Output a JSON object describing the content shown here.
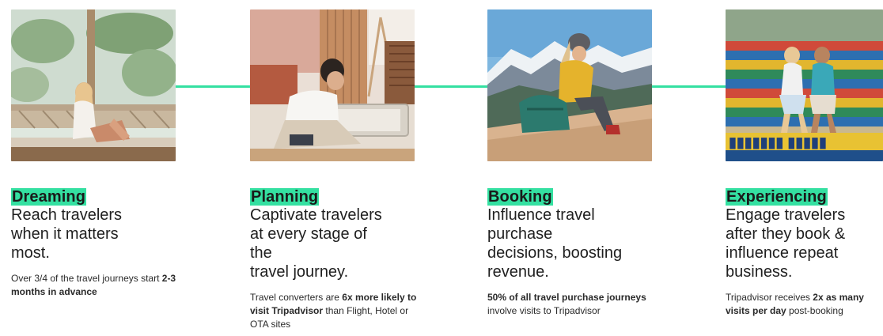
{
  "brand": {
    "accent": "#34e0a1"
  },
  "stages": [
    {
      "tag": "Dreaming",
      "headline": "Reach travelers\nwhen it matters\nmost.",
      "note_before": "Over 3/4 of the travel journeys start ",
      "note_bold": "2-3 months in advance",
      "note_after": "",
      "image": "woman sitting by window with palm trees"
    },
    {
      "tag": "Planning",
      "headline": "Captivate travelers\nat every stage of\nthe\ntravel journey.",
      "note_before": "Travel converters are ",
      "note_bold": "6x more likely to visit Tripadvisor",
      "note_after": " than Flight, Hotel or OTA sites",
      "image": "woman lying on floor reading beside suitcase"
    },
    {
      "tag": "Booking",
      "headline": "Influence travel\npurchase\ndecisions, boosting\nrevenue.",
      "note_before": "",
      "note_bold": "50% of all travel purchase journeys",
      "note_after": " involve visits to Tripadvisor",
      "image": "hiker sitting on mountain with phone"
    },
    {
      "tag": "Experiencing",
      "headline": "Engage travelers\nafter they book &\ninfluence repeat\nbusiness.",
      "note_before": "Tripadvisor receives ",
      "note_bold": "2x as many visits per day",
      "note_after": " post-booking",
      "image": "couple sitting on colorful tiled steps"
    }
  ]
}
